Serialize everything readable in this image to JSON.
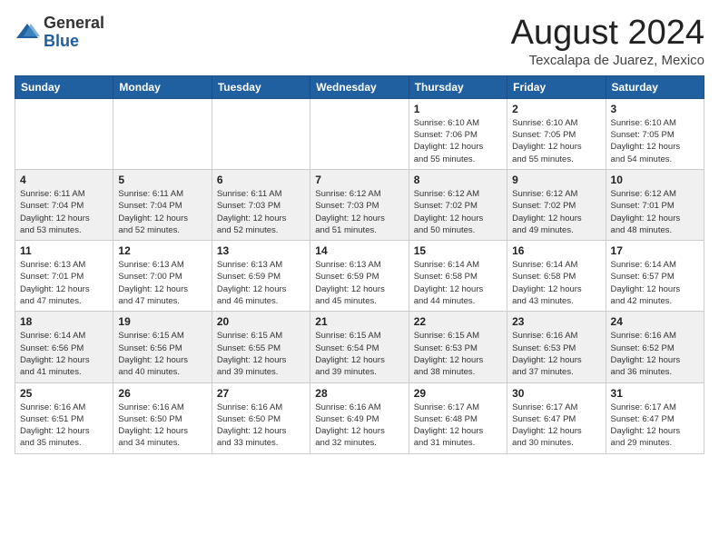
{
  "header": {
    "logo_general": "General",
    "logo_blue": "Blue",
    "month_title": "August 2024",
    "location": "Texcalapa de Juarez, Mexico"
  },
  "days_of_week": [
    "Sunday",
    "Monday",
    "Tuesday",
    "Wednesday",
    "Thursday",
    "Friday",
    "Saturday"
  ],
  "weeks": [
    [
      {
        "day": "",
        "info": ""
      },
      {
        "day": "",
        "info": ""
      },
      {
        "day": "",
        "info": ""
      },
      {
        "day": "",
        "info": ""
      },
      {
        "day": "1",
        "info": "Sunrise: 6:10 AM\nSunset: 7:06 PM\nDaylight: 12 hours\nand 55 minutes."
      },
      {
        "day": "2",
        "info": "Sunrise: 6:10 AM\nSunset: 7:05 PM\nDaylight: 12 hours\nand 55 minutes."
      },
      {
        "day": "3",
        "info": "Sunrise: 6:10 AM\nSunset: 7:05 PM\nDaylight: 12 hours\nand 54 minutes."
      }
    ],
    [
      {
        "day": "4",
        "info": "Sunrise: 6:11 AM\nSunset: 7:04 PM\nDaylight: 12 hours\nand 53 minutes."
      },
      {
        "day": "5",
        "info": "Sunrise: 6:11 AM\nSunset: 7:04 PM\nDaylight: 12 hours\nand 52 minutes."
      },
      {
        "day": "6",
        "info": "Sunrise: 6:11 AM\nSunset: 7:03 PM\nDaylight: 12 hours\nand 52 minutes."
      },
      {
        "day": "7",
        "info": "Sunrise: 6:12 AM\nSunset: 7:03 PM\nDaylight: 12 hours\nand 51 minutes."
      },
      {
        "day": "8",
        "info": "Sunrise: 6:12 AM\nSunset: 7:02 PM\nDaylight: 12 hours\nand 50 minutes."
      },
      {
        "day": "9",
        "info": "Sunrise: 6:12 AM\nSunset: 7:02 PM\nDaylight: 12 hours\nand 49 minutes."
      },
      {
        "day": "10",
        "info": "Sunrise: 6:12 AM\nSunset: 7:01 PM\nDaylight: 12 hours\nand 48 minutes."
      }
    ],
    [
      {
        "day": "11",
        "info": "Sunrise: 6:13 AM\nSunset: 7:01 PM\nDaylight: 12 hours\nand 47 minutes."
      },
      {
        "day": "12",
        "info": "Sunrise: 6:13 AM\nSunset: 7:00 PM\nDaylight: 12 hours\nand 47 minutes."
      },
      {
        "day": "13",
        "info": "Sunrise: 6:13 AM\nSunset: 6:59 PM\nDaylight: 12 hours\nand 46 minutes."
      },
      {
        "day": "14",
        "info": "Sunrise: 6:13 AM\nSunset: 6:59 PM\nDaylight: 12 hours\nand 45 minutes."
      },
      {
        "day": "15",
        "info": "Sunrise: 6:14 AM\nSunset: 6:58 PM\nDaylight: 12 hours\nand 44 minutes."
      },
      {
        "day": "16",
        "info": "Sunrise: 6:14 AM\nSunset: 6:58 PM\nDaylight: 12 hours\nand 43 minutes."
      },
      {
        "day": "17",
        "info": "Sunrise: 6:14 AM\nSunset: 6:57 PM\nDaylight: 12 hours\nand 42 minutes."
      }
    ],
    [
      {
        "day": "18",
        "info": "Sunrise: 6:14 AM\nSunset: 6:56 PM\nDaylight: 12 hours\nand 41 minutes."
      },
      {
        "day": "19",
        "info": "Sunrise: 6:15 AM\nSunset: 6:56 PM\nDaylight: 12 hours\nand 40 minutes."
      },
      {
        "day": "20",
        "info": "Sunrise: 6:15 AM\nSunset: 6:55 PM\nDaylight: 12 hours\nand 39 minutes."
      },
      {
        "day": "21",
        "info": "Sunrise: 6:15 AM\nSunset: 6:54 PM\nDaylight: 12 hours\nand 39 minutes."
      },
      {
        "day": "22",
        "info": "Sunrise: 6:15 AM\nSunset: 6:53 PM\nDaylight: 12 hours\nand 38 minutes."
      },
      {
        "day": "23",
        "info": "Sunrise: 6:16 AM\nSunset: 6:53 PM\nDaylight: 12 hours\nand 37 minutes."
      },
      {
        "day": "24",
        "info": "Sunrise: 6:16 AM\nSunset: 6:52 PM\nDaylight: 12 hours\nand 36 minutes."
      }
    ],
    [
      {
        "day": "25",
        "info": "Sunrise: 6:16 AM\nSunset: 6:51 PM\nDaylight: 12 hours\nand 35 minutes."
      },
      {
        "day": "26",
        "info": "Sunrise: 6:16 AM\nSunset: 6:50 PM\nDaylight: 12 hours\nand 34 minutes."
      },
      {
        "day": "27",
        "info": "Sunrise: 6:16 AM\nSunset: 6:50 PM\nDaylight: 12 hours\nand 33 minutes."
      },
      {
        "day": "28",
        "info": "Sunrise: 6:16 AM\nSunset: 6:49 PM\nDaylight: 12 hours\nand 32 minutes."
      },
      {
        "day": "29",
        "info": "Sunrise: 6:17 AM\nSunset: 6:48 PM\nDaylight: 12 hours\nand 31 minutes."
      },
      {
        "day": "30",
        "info": "Sunrise: 6:17 AM\nSunset: 6:47 PM\nDaylight: 12 hours\nand 30 minutes."
      },
      {
        "day": "31",
        "info": "Sunrise: 6:17 AM\nSunset: 6:47 PM\nDaylight: 12 hours\nand 29 minutes."
      }
    ]
  ]
}
